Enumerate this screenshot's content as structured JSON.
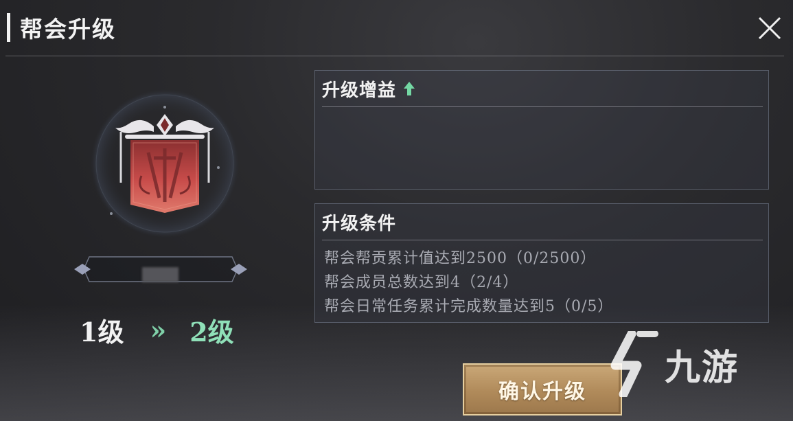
{
  "header": {
    "title": "帮会升级"
  },
  "level": {
    "current": "1级",
    "arrow": "»",
    "next": "2级"
  },
  "benefit_panel": {
    "title": "升级增益"
  },
  "condition_panel": {
    "title": "升级条件",
    "items": [
      "帮会帮贡累计值达到2500（0/2500）",
      "帮会成员总数达到4（2/4）",
      "帮会日常任务累计完成数量达到5（0/5）"
    ]
  },
  "confirm_button": {
    "label": "确认升级"
  },
  "watermark": {
    "text": "九游"
  },
  "colors": {
    "accent_green": "#7fd0a8",
    "button_gold": "#b08a5a",
    "emblem_red": "#c44a48"
  }
}
